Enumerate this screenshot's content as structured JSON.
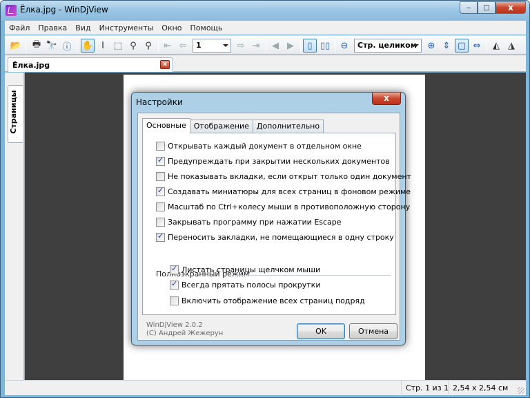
{
  "window": {
    "title": "Ёлка.jpg - WinDjView",
    "minimize": "‒",
    "maximize": "□",
    "close": "x"
  },
  "menu": [
    "Файл",
    "Правка",
    "Вид",
    "Инструменты",
    "Окно",
    "Помощь"
  ],
  "toolbar": {
    "page_number": "1",
    "zoom_mode": "Стр. целиком",
    "icons": [
      "open-icon",
      "print-icon",
      "find-icon",
      "info-icon",
      "hand-icon",
      "select-text-icon",
      "select-rect-icon",
      "zoom-icon",
      "magnify-icon",
      "first-page-icon",
      "prev-page-icon",
      "next-page-icon",
      "last-page-icon",
      "back-icon",
      "forward-icon",
      "single-page-icon",
      "facing-pages-icon",
      "zoom-out-icon",
      "zoom-in-icon",
      "fit-width-icon",
      "fit-page-icon",
      "rotate-icon",
      "rotate-left-icon",
      "rotate-right-icon"
    ]
  },
  "tab": {
    "label": "Ёлка.jpg",
    "close": "x"
  },
  "sidebar": {
    "tab_label": "Страницы"
  },
  "status": {
    "page": "Стр. 1 из 1",
    "size": "2,54 x 2,54 см"
  },
  "dialog": {
    "title": "Настройки",
    "close": "x",
    "tabs": [
      "Основные",
      "Отображение",
      "Дополнительно"
    ],
    "options": [
      {
        "label": "Открывать каждый документ в отдельном окне",
        "checked": false
      },
      {
        "label": "Предупреждать при закрытии нескольких документов",
        "checked": true
      },
      {
        "label": "Не показывать вкладки, если открыт только один документ",
        "checked": false
      },
      {
        "label": "Создавать миниатюры для всех страниц в фоновом режиме",
        "checked": true
      },
      {
        "label": "Масштаб по Ctrl+колесу мыши в противоположную сторону",
        "checked": false
      },
      {
        "label": "Закрывать программу при нажатии Escape",
        "checked": false
      },
      {
        "label": "Переносить закладки, не помещающиеся в одну строку",
        "checked": true
      }
    ],
    "fullscreen_group": "Полноэкранный режим",
    "fullscreen_options": [
      {
        "label": "Листать страницы щелчком мыши",
        "checked": true
      },
      {
        "label": "Всегда прятать полосы прокрутки",
        "checked": true
      },
      {
        "label": "Включить отображение всех страниц подряд",
        "checked": false
      }
    ],
    "version": "WinDjView 2.0.2",
    "copyright": "(C) Андрей Жежерун",
    "ok": "OK",
    "cancel": "Отмена"
  }
}
